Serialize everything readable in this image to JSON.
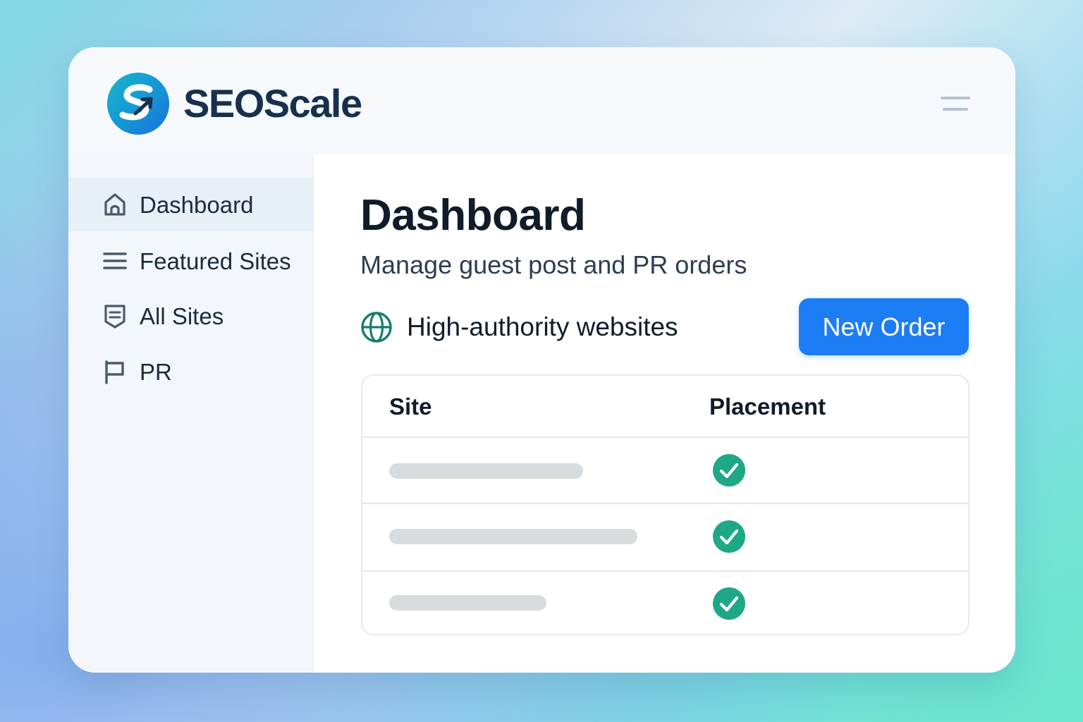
{
  "app": {
    "brand": "SEOScale"
  },
  "sidebar": {
    "items": [
      {
        "label": "Dashboard",
        "icon": "home-icon",
        "active": true
      },
      {
        "label": "Featured Sites",
        "icon": "list-icon",
        "active": false
      },
      {
        "label": "All Sites",
        "icon": "document-icon",
        "active": false
      },
      {
        "label": "PR",
        "icon": "flag-icon",
        "active": false
      }
    ]
  },
  "main": {
    "title": "Dashboard",
    "subtitle": "Manage guest post and PR orders",
    "section_label": "High-authority websites",
    "new_order_label": "New Order",
    "table": {
      "columns": [
        "Site",
        "Placement"
      ],
      "rows": [
        {
          "site_placeholder_fill": 0.32,
          "placement": "checked"
        },
        {
          "site_placeholder_fill": 0.41,
          "placement": "checked"
        },
        {
          "site_placeholder_fill": 0.26,
          "placement": "checked"
        }
      ]
    }
  },
  "colors": {
    "accent": "#1c7df5",
    "success": "#1fa886",
    "text_dark": "#111c2a",
    "brand_text": "#17304d"
  }
}
